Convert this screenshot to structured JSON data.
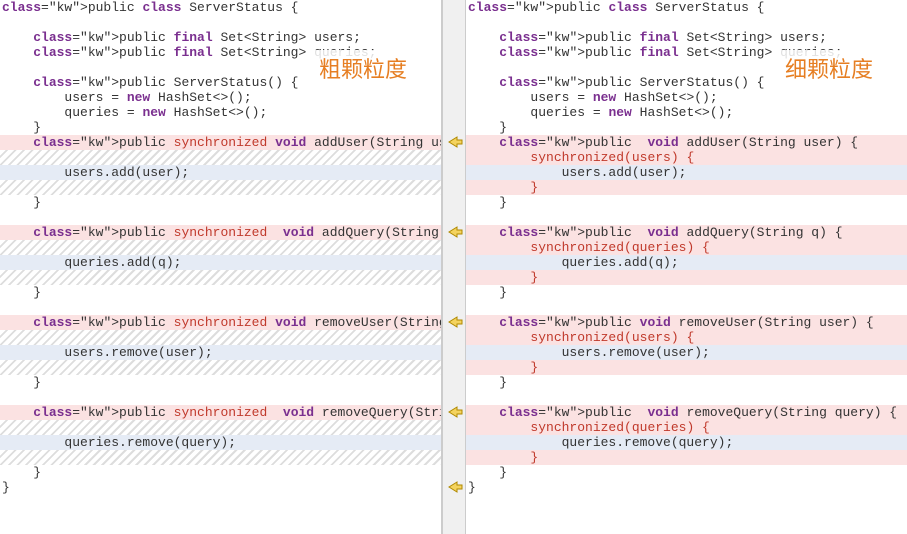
{
  "annotations": {
    "left": "粗颗粒度",
    "right": "细颗粒度"
  },
  "left": {
    "lines": [
      {
        "t": "public class ServerStatus {",
        "bg": ""
      },
      {
        "t": "",
        "bg": ""
      },
      {
        "t": "    public final Set<String> users;",
        "bg": ""
      },
      {
        "t": "    public final Set<String> queries;",
        "bg": ""
      },
      {
        "t": "",
        "bg": ""
      },
      {
        "t": "    public ServerStatus() {",
        "bg": ""
      },
      {
        "t": "        users = new HashSet<>();",
        "bg": ""
      },
      {
        "t": "        queries = new HashSet<>();",
        "bg": ""
      },
      {
        "t": "    }",
        "bg": ""
      },
      {
        "t": "    public ~synchronized~ void addUser(String user) {",
        "bg": "pink"
      },
      {
        "t": "",
        "bg": "hatch"
      },
      {
        "t": "        users.add(user);",
        "bg": "blue"
      },
      {
        "t": "",
        "bg": "hatch"
      },
      {
        "t": "    }",
        "bg": ""
      },
      {
        "t": "",
        "bg": ""
      },
      {
        "t": "    public ~synchronized~  void addQuery(String q) {",
        "bg": "pink"
      },
      {
        "t": "",
        "bg": "hatch"
      },
      {
        "t": "        queries.add(q);",
        "bg": "blue"
      },
      {
        "t": "",
        "bg": "hatch"
      },
      {
        "t": "    }",
        "bg": ""
      },
      {
        "t": "",
        "bg": ""
      },
      {
        "t": "    public ~synchronized~ void removeUser(String user) {",
        "bg": "pink"
      },
      {
        "t": "",
        "bg": "hatch"
      },
      {
        "t": "        users.remove(user);",
        "bg": "blue"
      },
      {
        "t": "",
        "bg": "hatch"
      },
      {
        "t": "    }",
        "bg": ""
      },
      {
        "t": "",
        "bg": ""
      },
      {
        "t": "    public ~synchronized~  void removeQuery(String query) {",
        "bg": "pink"
      },
      {
        "t": "",
        "bg": "hatch"
      },
      {
        "t": "        queries.remove(query);",
        "bg": "blue"
      },
      {
        "t": "",
        "bg": "hatch"
      },
      {
        "t": "    }",
        "bg": ""
      },
      {
        "t": "}",
        "bg": ""
      }
    ]
  },
  "right": {
    "lines": [
      {
        "t": "public class ServerStatus {",
        "bg": ""
      },
      {
        "t": "",
        "bg": ""
      },
      {
        "t": "    public final Set<String> users;",
        "bg": ""
      },
      {
        "t": "    public final Set<String> queries;",
        "bg": ""
      },
      {
        "t": "",
        "bg": ""
      },
      {
        "t": "    public ServerStatus() {",
        "bg": ""
      },
      {
        "t": "        users = new HashSet<>();",
        "bg": ""
      },
      {
        "t": "        queries = new HashSet<>();",
        "bg": ""
      },
      {
        "t": "    }",
        "bg": ""
      },
      {
        "t": "    public  void addUser(String user) {",
        "bg": "pink"
      },
      {
        "t": "        ~synchronized(users) {~",
        "bg": "pink"
      },
      {
        "t": "            users.add(user);",
        "bg": "blue"
      },
      {
        "t": "        ~}~",
        "bg": "pink"
      },
      {
        "t": "    }",
        "bg": ""
      },
      {
        "t": "",
        "bg": ""
      },
      {
        "t": "    public  void addQuery(String q) {",
        "bg": "pink"
      },
      {
        "t": "        ~synchronized(queries) {~",
        "bg": "pink"
      },
      {
        "t": "            queries.add(q);",
        "bg": "blue"
      },
      {
        "t": "        ~}~",
        "bg": "pink"
      },
      {
        "t": "    }",
        "bg": ""
      },
      {
        "t": "",
        "bg": ""
      },
      {
        "t": "    public void removeUser(String user) {",
        "bg": "pink"
      },
      {
        "t": "        ~synchronized(users) {~",
        "bg": "pink"
      },
      {
        "t": "            users.remove(user);",
        "bg": "blue"
      },
      {
        "t": "        ~}~",
        "bg": "pink"
      },
      {
        "t": "    }",
        "bg": ""
      },
      {
        "t": "",
        "bg": ""
      },
      {
        "t": "    public  void removeQuery(String query) {",
        "bg": "pink"
      },
      {
        "t": "        ~synchronized(queries) {~",
        "bg": "pink"
      },
      {
        "t": "            queries.remove(query);",
        "bg": "blue"
      },
      {
        "t": "        ~}~",
        "bg": "pink"
      },
      {
        "t": "    }",
        "bg": ""
      },
      {
        "t": "}",
        "bg": ""
      }
    ]
  },
  "markers": [
    9,
    15,
    21,
    27,
    32
  ],
  "keywords": [
    "public",
    "class",
    "final",
    "void",
    "new"
  ]
}
